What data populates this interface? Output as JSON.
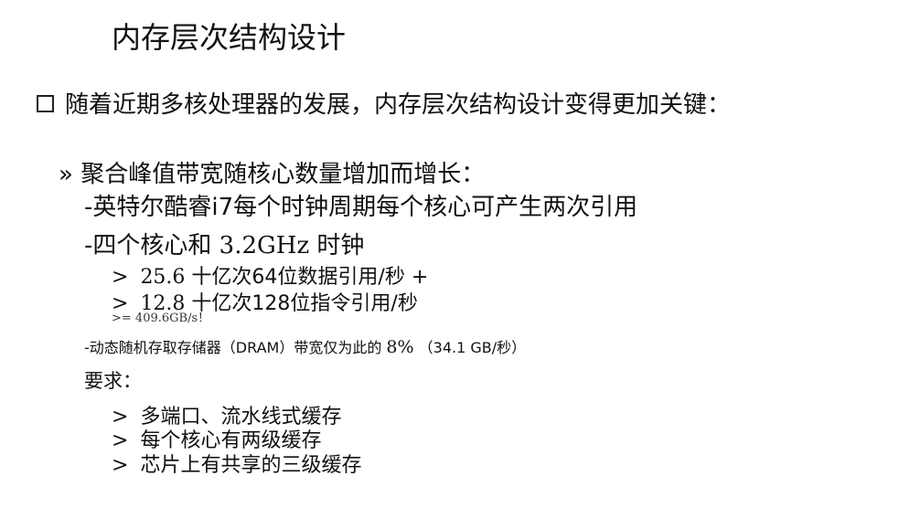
{
  "slide": {
    "title": "内存层次结构设计",
    "bullet": "随着近期多核处理器的发展，内存层次结构设计变得更加关键：",
    "subheading_marker": "»",
    "subheading": "聚合峰值带宽随核心数量增加而增长：",
    "line_intel": "-英特尔酷睿i7每个时钟周期每个核心可产生两次引用",
    "line_cores_prefix": "-四个核心和",
    "line_cores_freq": "3.2GHz",
    "line_cores_suffix": "时钟",
    "gt_symbol": ">",
    "line_data_num": "25.6",
    "line_data_text": "十亿次64位数据引用/秒 +",
    "line_instr_num": "12.8",
    "line_instr_text": "十亿次128位指令引用/秒",
    "line_total": ">= 409.6GB/s！",
    "line_dram_text": "-动态随机存取存储器（DRAM）带宽仅为此的",
    "line_dram_pct": "8%",
    "line_dram_paren": "（34.1 GB/秒）",
    "requirements_label": "要求：",
    "req_1": "多端口、流水线式缓存",
    "req_2": "每个核心有两级缓存",
    "req_3": "芯片上有共享的三级缓存"
  }
}
